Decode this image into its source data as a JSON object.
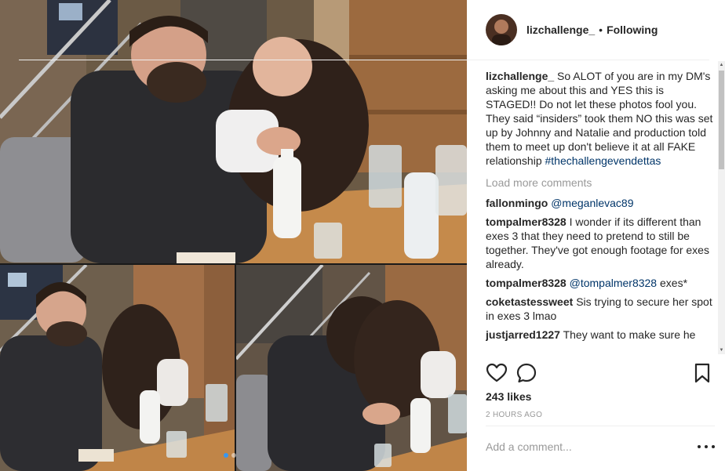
{
  "post": {
    "author": "lizchallenge_",
    "follow_status": "Following",
    "separator": "•"
  },
  "caption": {
    "username": "lizchallenge_",
    "text": "So ALOT of you are in my DM's asking me about this and YES this is STAGED!! Do not let these photos fool you. They said “insiders” took them NO this was set up by Johnny and Natalie and production told them to meet up don't believe it at all FAKE relationship",
    "hashtag": "#thechallengevendettas"
  },
  "load_more_label": "Load more comments",
  "comments": [
    {
      "username": "fallonmingo",
      "mention": "@meganlevac89",
      "text": ""
    },
    {
      "username": "tompalmer8328",
      "mention": "",
      "text": "I wonder if its different than exes 3 that they need to pretend to still be together. They've got enough footage for exes already."
    },
    {
      "username": "tompalmer8328",
      "mention": "@tompalmer8328",
      "text": "exes*"
    },
    {
      "username": "coketastessweet",
      "mention": "",
      "text": "Sis trying to secure her spot in exes 3 lmao"
    },
    {
      "username": "justjarred1227",
      "mention": "",
      "text": "They want to make sure he"
    }
  ],
  "likes": "243 likes",
  "timestamp": "2 HOURS AGO",
  "add_comment_placeholder": "Add a comment...",
  "icons": {
    "like": "heart-icon",
    "comment": "speech-bubble-icon",
    "save": "bookmark-icon",
    "more": "more-options-icon"
  },
  "colors": {
    "link": "#003569",
    "muted": "#999999",
    "text": "#262626",
    "carousel_active": "#3897f0"
  },
  "carousel": {
    "count": 2,
    "active_index": 1
  }
}
